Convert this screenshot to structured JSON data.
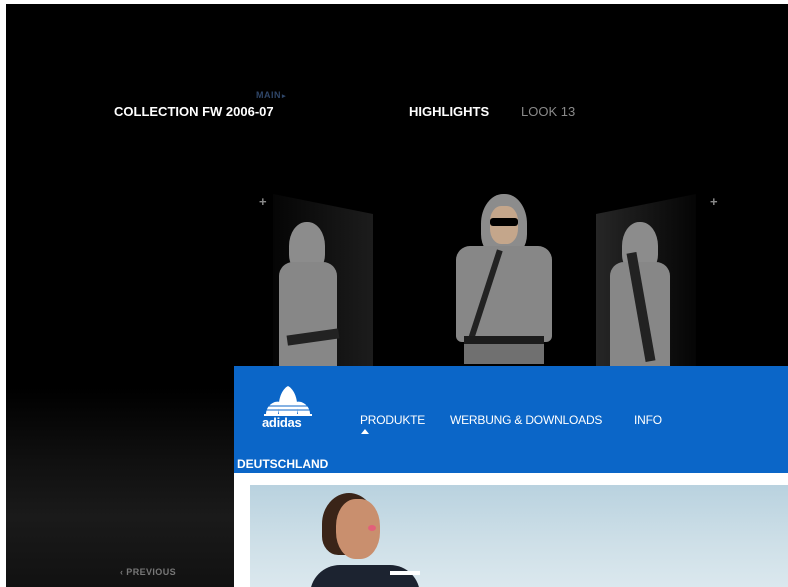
{
  "collection": {
    "main_label": "MAIN",
    "main_caret": "▸",
    "title": "COLLECTION FW 2006-07",
    "highlights_label": "HIGHLIGHTS",
    "look_label": "LOOK 13",
    "plus_left": "+",
    "plus_right": "+",
    "previous_label": "‹  PREVIOUS"
  },
  "adidas": {
    "brand": "adidas",
    "nav": {
      "produkte": "PRODUKTE",
      "werbung": "WERBUNG & DOWNLOADS",
      "info": "INFO"
    },
    "country": "DEUTSCHLAND",
    "colors": {
      "bar": "#0b66c8",
      "text": "#ffffff"
    }
  },
  "icons": [
    "trefoil-logo-icon",
    "nav-caret-icon",
    "plus-icon",
    "chevron-left-icon"
  ]
}
